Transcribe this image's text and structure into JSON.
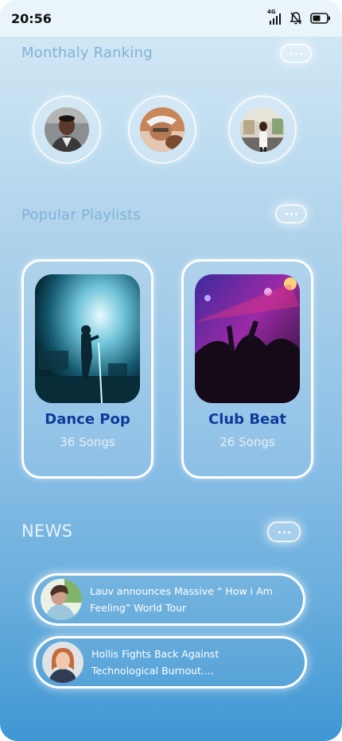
{
  "status_bar": {
    "time": "20:56",
    "network_label": "4G",
    "icons": [
      "signal-icon",
      "bell-muted-icon",
      "battery-icon"
    ]
  },
  "ranking": {
    "title": "Monthaly Ranking",
    "more_icon": "more-dots-icon",
    "avatars": [
      {
        "name": "ranked-user-1"
      },
      {
        "name": "ranked-user-2"
      },
      {
        "name": "ranked-user-3"
      }
    ]
  },
  "playlists": {
    "title": "Popular Playlists",
    "more_icon": "more-dots-icon",
    "items": [
      {
        "name": "Dance Pop",
        "count": "36 Songs"
      },
      {
        "name": "Club Beat",
        "count": "26 Songs"
      }
    ]
  },
  "news": {
    "title": "NEWS",
    "more_icon": "more-dots-icon",
    "items": [
      {
        "line1": "Lauv announces Massive “ How i Am",
        "line2": "Feeling” World Tour"
      },
      {
        "line1": "Hollis Fights Back Against",
        "line2": "Technological Burnout...."
      }
    ]
  },
  "colors": {
    "accent_title": "#0f3a9c",
    "section_title": "#7fb3d6",
    "background_top": "#d7ebf6",
    "background_bottom": "#3f97d3"
  }
}
